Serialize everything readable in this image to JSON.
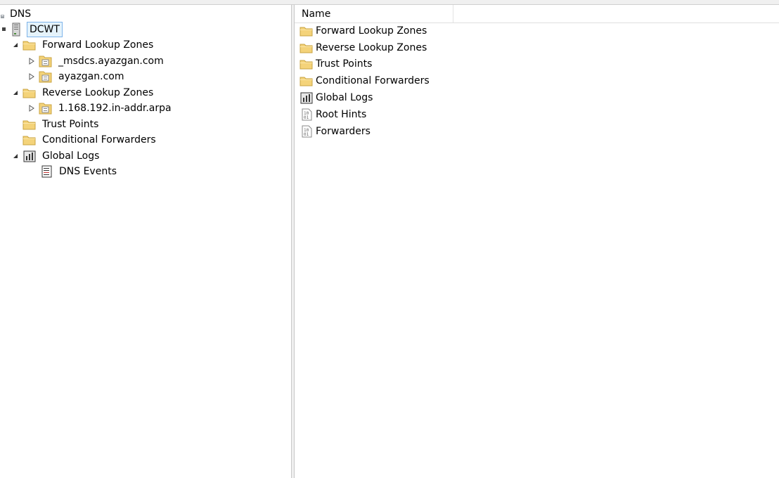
{
  "tree": {
    "root_label": "DNS",
    "server_label": "DCWT",
    "items": [
      {
        "label": "Forward Lookup Zones",
        "icon": "folder-icon",
        "toggle": "expanded"
      },
      {
        "label": "_msdcs.ayazgan.com",
        "icon": "zone-icon",
        "toggle": "collapsed"
      },
      {
        "label": "ayazgan.com",
        "icon": "zone-icon",
        "toggle": "collapsed"
      },
      {
        "label": "Reverse Lookup Zones",
        "icon": "folder-icon",
        "toggle": "expanded"
      },
      {
        "label": "1.168.192.in-addr.arpa",
        "icon": "zone-icon",
        "toggle": "collapsed"
      },
      {
        "label": "Trust Points",
        "icon": "folder-icon",
        "toggle": "none"
      },
      {
        "label": "Conditional Forwarders",
        "icon": "folder-icon",
        "toggle": "none"
      },
      {
        "label": "Global Logs",
        "icon": "log-icon",
        "toggle": "expanded"
      },
      {
        "label": "DNS Events",
        "icon": "event-log-icon",
        "toggle": "none"
      }
    ]
  },
  "list": {
    "column_name": "Name",
    "rows": [
      {
        "label": "Forward Lookup Zones",
        "icon": "folder-icon"
      },
      {
        "label": "Reverse Lookup Zones",
        "icon": "folder-icon"
      },
      {
        "label": "Trust Points",
        "icon": "folder-icon"
      },
      {
        "label": "Conditional Forwarders",
        "icon": "folder-icon"
      },
      {
        "label": "Global Logs",
        "icon": "log-icon"
      },
      {
        "label": "Root Hints",
        "icon": "binary-file-icon"
      },
      {
        "label": "Forwarders",
        "icon": "binary-file-icon"
      }
    ]
  },
  "colors": {
    "folder": "#f4d37a",
    "selection_bg": "#e5f3fb",
    "selection_border": "#7eb4ea"
  }
}
